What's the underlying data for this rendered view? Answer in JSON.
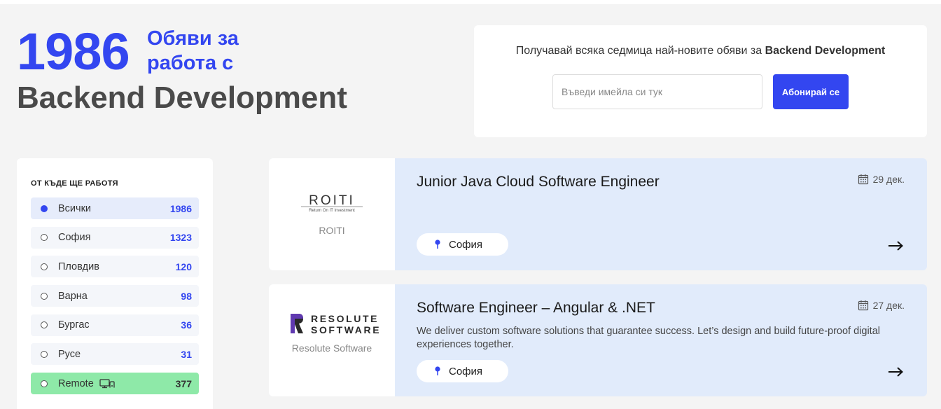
{
  "hero": {
    "count": "1986",
    "subtitle": "Обяви за работа с",
    "category": "Backend Development"
  },
  "subscribe": {
    "text_prefix": "Получавай всяка седмица най-новите обяви за ",
    "text_bold": "Backend Development",
    "input_placeholder": "Въведи имейла си тук",
    "button_label": "Абонирай се"
  },
  "sidebar": {
    "title": "ОТ КЪДЕ ЩЕ РАБОТЯ",
    "locations": [
      {
        "label": "Всички",
        "count": "1986",
        "selected": true
      },
      {
        "label": "София",
        "count": "1323"
      },
      {
        "label": "Пловдив",
        "count": "120"
      },
      {
        "label": "Варна",
        "count": "98"
      },
      {
        "label": "Бургас",
        "count": "36"
      },
      {
        "label": "Русе",
        "count": "31"
      },
      {
        "label": "Remote",
        "count": "377",
        "icon": "remote-work-icon"
      }
    ]
  },
  "jobs": [
    {
      "company": "ROITI",
      "logo_text": "ROITI",
      "logo_tagline": "Return On IT Investment",
      "title": "Junior Java Cloud Software Engineer",
      "date": "29 дек.",
      "description": "",
      "location": "София"
    },
    {
      "company": "Resolute Software",
      "logo_line1": "RESOLUTE",
      "logo_line2": "SOFTWARE",
      "title": "Software Engineer – Angular & .NET",
      "date": "27 дек.",
      "description": "We deliver custom software solutions that guarantee success. Let’s design and build future-proof digital experiences together.",
      "location": "София"
    }
  ],
  "colors": {
    "accent": "#3346f0",
    "card_bg": "#e1ebfb",
    "remote_bg": "#8ee9a8",
    "heading_gray": "#4a4a4a"
  }
}
